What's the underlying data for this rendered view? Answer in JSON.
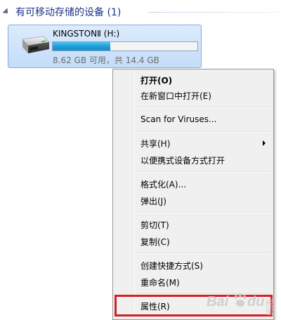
{
  "group": {
    "title": "有可移动存储的设备 (1)"
  },
  "drive": {
    "name": "KINGSTONⅡ (H:)",
    "space_text": "8.62 GB 可用，共 14.4 GB",
    "used_fraction": 0.4,
    "bar_color": "#1ea0dc"
  },
  "context_menu": {
    "items": [
      {
        "label": "打开(O)",
        "bold": true
      },
      {
        "label": "在新窗口中打开(E)"
      },
      {
        "label": "Scan for Viruses..."
      },
      {
        "label": "共享(H)",
        "has_submenu": true
      },
      {
        "label": "以便携式设备方式打开"
      },
      {
        "label": "格式化(A)..."
      },
      {
        "label": "弹出(J)"
      },
      {
        "label": "剪切(T)"
      },
      {
        "label": "复制(C)"
      },
      {
        "label": "创建快捷方式(S)"
      },
      {
        "label": "重命名(M)"
      },
      {
        "label": "属性(R)"
      }
    ]
  },
  "highlight": {
    "color": "#d41f24",
    "target": "属性(R)"
  },
  "watermark": {
    "text": "Baidu 经验"
  }
}
